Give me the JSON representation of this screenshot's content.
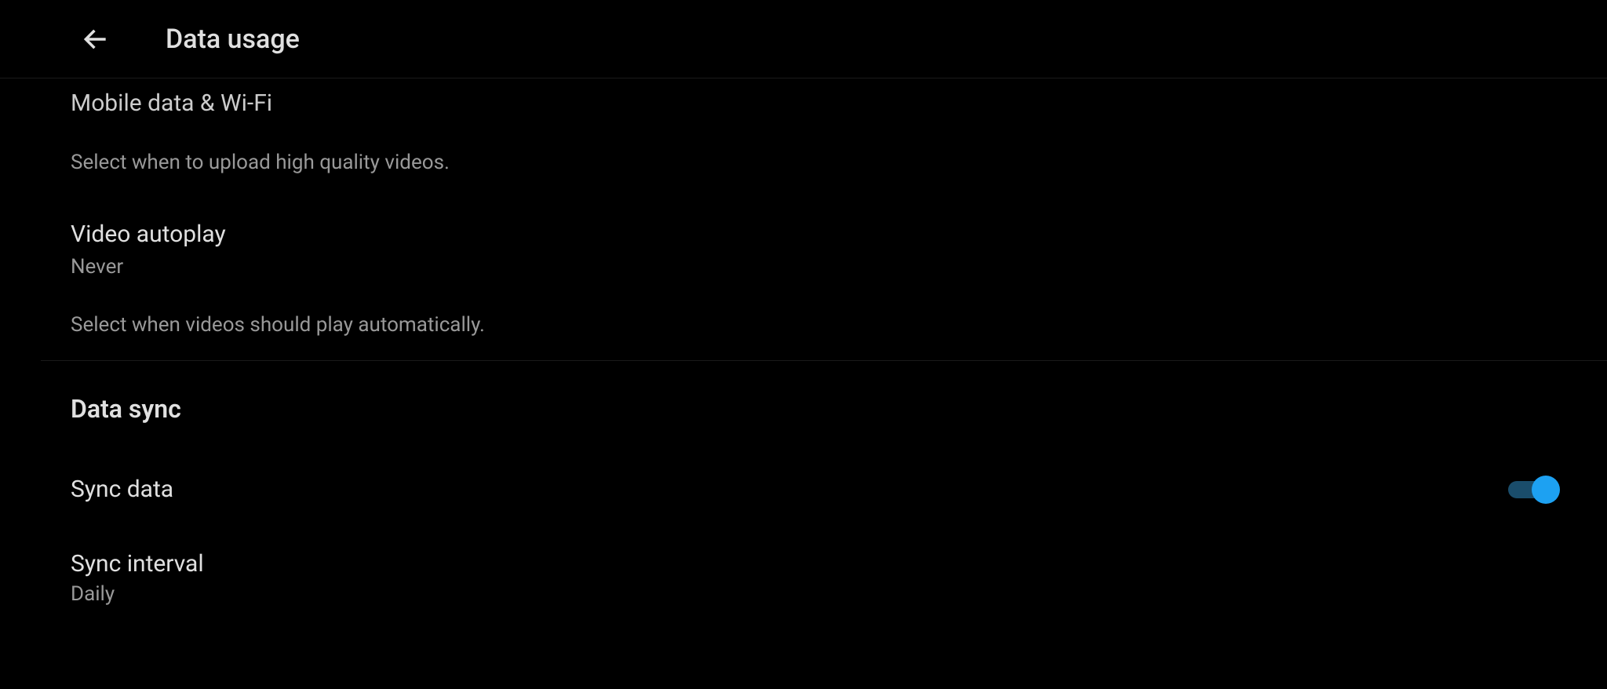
{
  "header": {
    "title": "Data usage"
  },
  "settings": {
    "uploadQuality": {
      "value": "Mobile data & Wi-Fi",
      "description": "Select when to upload high quality videos."
    },
    "videoAutoplay": {
      "title": "Video autoplay",
      "value": "Never",
      "description": "Select when videos should play automatically."
    }
  },
  "dataSync": {
    "sectionTitle": "Data sync",
    "syncData": {
      "label": "Sync data",
      "enabled": true
    },
    "syncInterval": {
      "title": "Sync interval",
      "value": "Daily"
    }
  }
}
